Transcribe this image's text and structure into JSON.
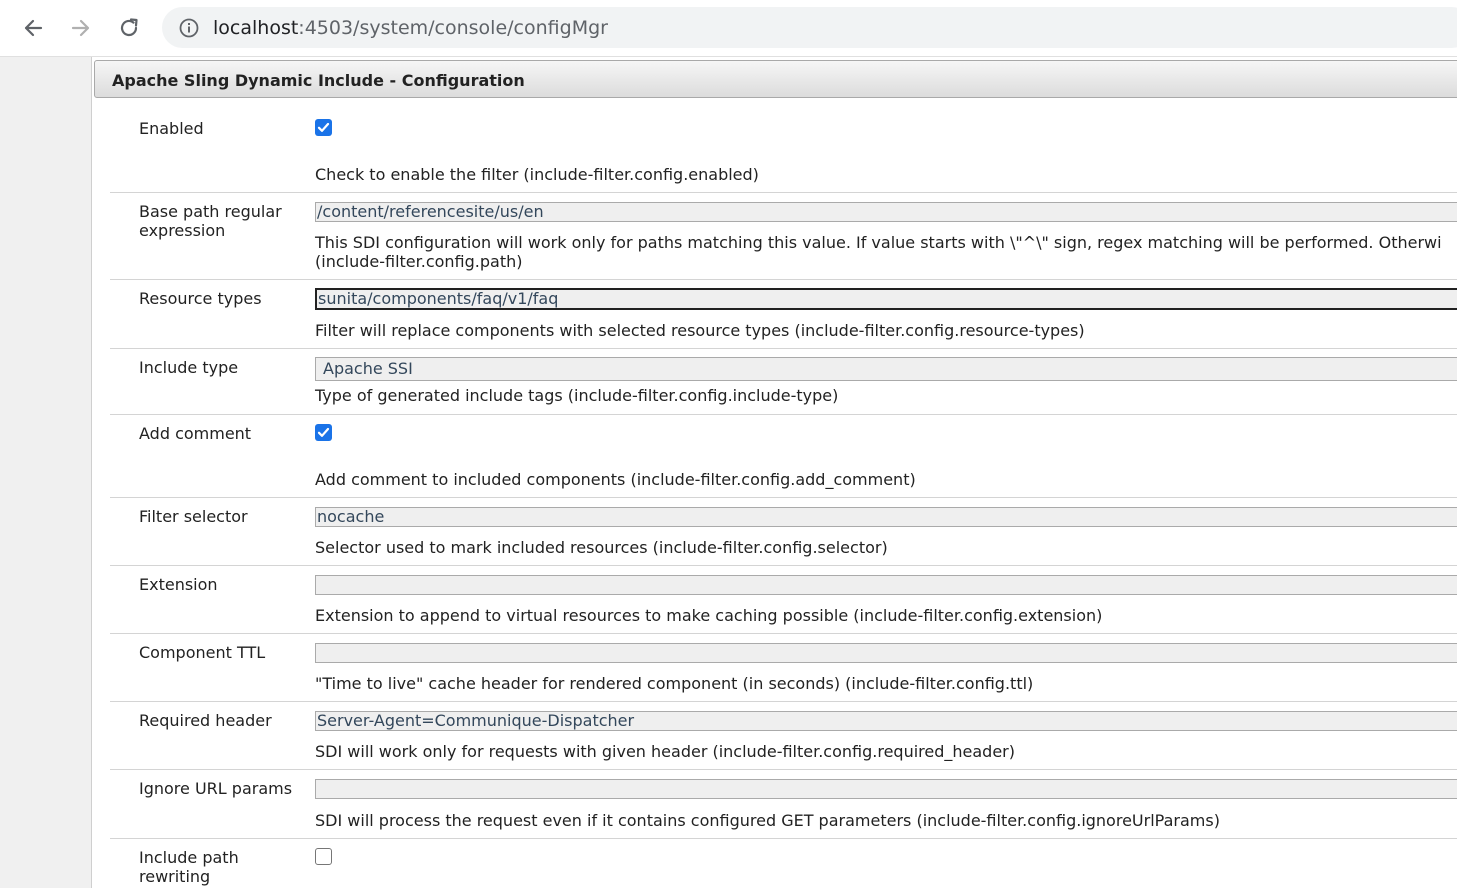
{
  "browser": {
    "url_host": "localhost",
    "url_path": ":4503/system/console/configMgr"
  },
  "dialog": {
    "title": "Apache Sling Dynamic Include - Configuration"
  },
  "fields": {
    "enabled": {
      "label": "Enabled",
      "checked": true,
      "help": "Check to enable the filter (include-filter.config.enabled)"
    },
    "base_path": {
      "label": "Base path regular expression",
      "value": "/content/referencesite/us/en",
      "help_line1": "This SDI configuration will work only for paths matching this value. If value starts with \\\"^\\\" sign, regex matching will be performed. Otherwi",
      "help_line2": "(include-filter.config.path)"
    },
    "resource_types": {
      "label": "Resource types",
      "value": "sunita/components/faq/v1/faq",
      "help": "Filter will replace components with selected resource types (include-filter.config.resource-types)"
    },
    "include_type": {
      "label": "Include type",
      "value": "Apache SSI",
      "help": "Type of generated include tags (include-filter.config.include-type)"
    },
    "add_comment": {
      "label": "Add comment",
      "checked": true,
      "help": "Add comment to included components (include-filter.config.add_comment)"
    },
    "filter_selector": {
      "label": "Filter selector",
      "value": "nocache",
      "help": "Selector used to mark included resources (include-filter.config.selector)"
    },
    "extension": {
      "label": "Extension",
      "value": "",
      "help": "Extension to append to virtual resources to make caching possible (include-filter.config.extension)"
    },
    "component_ttl": {
      "label": "Component TTL",
      "value": "",
      "help": "\"Time to live\" cache header for rendered component (in seconds) (include-filter.config.ttl)"
    },
    "required_header": {
      "label": "Required header",
      "value": "Server-Agent=Communique-Dispatcher",
      "help": "SDI will work only for requests with given header (include-filter.config.required_header)"
    },
    "ignore_url_params": {
      "label": "Ignore URL params",
      "value": "",
      "help": "SDI will process the request even if it contains configured GET parameters (include-filter.config.ignoreUrlParams)"
    },
    "include_path_rewriting": {
      "label": "Include path rewriting",
      "checked": false
    }
  },
  "colors": {
    "checkbox_accent": "#1a73e8",
    "header_gradient_top": "#f6f6f6",
    "header_gradient_bottom": "#dcdcdc"
  },
  "icons": [
    "back-arrow-icon",
    "forward-arrow-icon",
    "reload-icon",
    "info-icon",
    "checkmark-icon"
  ]
}
